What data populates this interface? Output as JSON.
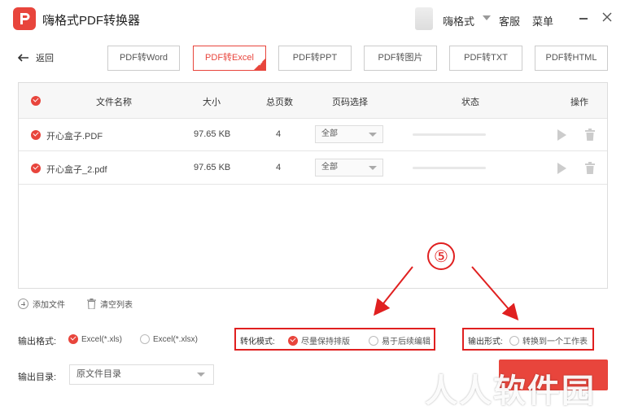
{
  "titlebar": {
    "app_title": "嗨格式PDF转换器",
    "user_name": "嗨格式",
    "service": "客服",
    "menu": "菜单"
  },
  "nav": {
    "back_label": "返回",
    "tabs": [
      {
        "label": "PDF转Word",
        "active": false
      },
      {
        "label": "PDF转Excel",
        "active": true
      },
      {
        "label": "PDF转PPT",
        "active": false
      },
      {
        "label": "PDF转图片",
        "active": false
      },
      {
        "label": "PDF转TXT",
        "active": false
      },
      {
        "label": "PDF转HTML",
        "active": false
      }
    ]
  },
  "table": {
    "headers": {
      "name": "文件名称",
      "size": "大小",
      "pages": "总页数",
      "page_select": "页码选择",
      "status": "状态",
      "action": "操作"
    },
    "rows": [
      {
        "name": "开心盒子.PDF",
        "size": "97.65 KB",
        "pages": "4",
        "page_select": "全部"
      },
      {
        "name": "开心盒子_2.pdf",
        "size": "97.65 KB",
        "pages": "4",
        "page_select": "全部"
      }
    ]
  },
  "actions": {
    "add_file": "添加文件",
    "clear_list": "清空列表"
  },
  "output_format": {
    "label": "输出格式:",
    "options": [
      {
        "label": "Excel(*.xls)",
        "selected": true
      },
      {
        "label": "Excel(*.xlsx)",
        "selected": false
      }
    ]
  },
  "convert_mode": {
    "label": "转化模式:",
    "options": [
      {
        "label": "尽量保持排版",
        "selected": true
      },
      {
        "label": "易于后续编辑",
        "selected": false
      }
    ]
  },
  "output_form": {
    "label": "输出形式:",
    "option": {
      "label": "转换到一个工作表",
      "selected": false
    }
  },
  "output_dir": {
    "label": "输出目录:",
    "value": "原文件目录"
  },
  "annotation": {
    "step": "⑤"
  },
  "watermark": "人人软件园",
  "colors": {
    "accent": "#e8453c",
    "highlight": "#e02020"
  }
}
